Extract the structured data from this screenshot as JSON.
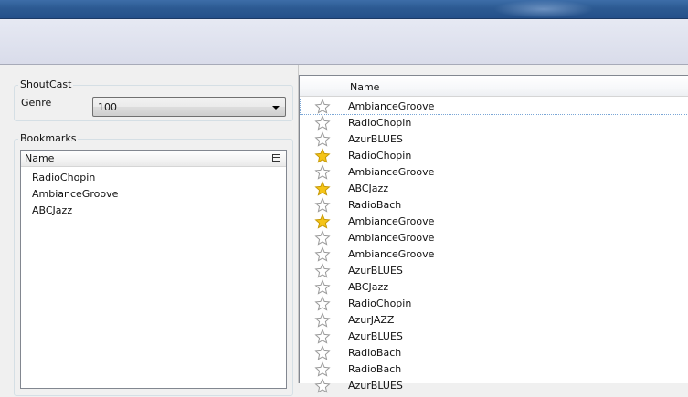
{
  "shoutcast": {
    "group_title": "ShoutCast",
    "genre_label": "Genre",
    "genre_value": "100"
  },
  "bookmarks": {
    "group_title": "Bookmarks",
    "column_name": "Name",
    "items": [
      "RadioChopin",
      "AmbianceGroove",
      "ABCJazz"
    ]
  },
  "stations": {
    "column_name": "Name",
    "rows": [
      {
        "name": "AmbianceGroove",
        "favorite": false
      },
      {
        "name": "RadioChopin",
        "favorite": false
      },
      {
        "name": "AzurBLUES",
        "favorite": false
      },
      {
        "name": "RadioChopin",
        "favorite": true
      },
      {
        "name": "AmbianceGroove",
        "favorite": false
      },
      {
        "name": "ABCJazz",
        "favorite": true
      },
      {
        "name": "RadioBach",
        "favorite": false
      },
      {
        "name": "AmbianceGroove",
        "favorite": true
      },
      {
        "name": "AmbianceGroove",
        "favorite": false
      },
      {
        "name": "AmbianceGroove",
        "favorite": false
      },
      {
        "name": "AzurBLUES",
        "favorite": false
      },
      {
        "name": "ABCJazz",
        "favorite": false
      },
      {
        "name": "RadioChopin",
        "favorite": false
      },
      {
        "name": "AzurJAZZ",
        "favorite": false
      },
      {
        "name": "AzurBLUES",
        "favorite": false
      },
      {
        "name": "RadioBach",
        "favorite": false
      },
      {
        "name": "RadioBach",
        "favorite": false
      },
      {
        "name": "AzurBLUES",
        "favorite": false
      }
    ]
  },
  "colors": {
    "star_filled": "#f5c417",
    "star_empty_stroke": "#9a9a9a"
  }
}
